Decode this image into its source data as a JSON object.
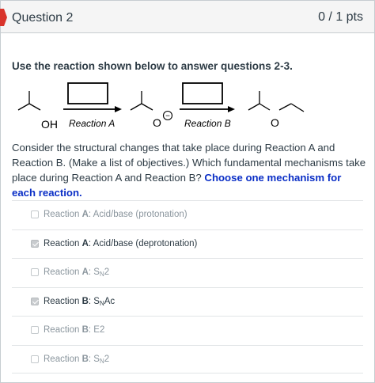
{
  "header": {
    "title": "Question 2",
    "points": "0 / 1 pts",
    "flag_color": "#d9342b"
  },
  "prompt": "Use the reaction shown below to answer questions 2-3.",
  "scheme": {
    "oh_label": "OH",
    "reaction_a": "Reaction A",
    "reaction_b": "Reaction B",
    "o_label": "O",
    "charge": "−"
  },
  "body": {
    "text": "Consider the structural changes that take place during Reaction A and Reaction B. (Make a list of objectives.) Which fundamental mechanisms take place during Reaction A and Reaction B?",
    "emphasis": "Choose one mechanism for each reaction."
  },
  "answers": [
    {
      "prefix": "Reaction A: ",
      "main": "Acid/base (protonation)",
      "sub": "",
      "tail": "",
      "checked": false,
      "style": "muted"
    },
    {
      "prefix": "Reaction A: ",
      "main": "Acid/base (deprotonation)",
      "sub": "",
      "tail": "",
      "checked": true,
      "style": "selected"
    },
    {
      "prefix": "Reaction A: ",
      "main": "S",
      "sub": "N",
      "tail": "2",
      "checked": false,
      "style": "muted"
    },
    {
      "prefix": "Reaction B: ",
      "main": "S",
      "sub": "N",
      "tail": "Ac",
      "checked": true,
      "style": "selected"
    },
    {
      "prefix": "Reaction B: ",
      "main": "E2",
      "sub": "",
      "tail": "",
      "checked": false,
      "style": "muted"
    },
    {
      "prefix": "Reaction B: ",
      "main": "S",
      "sub": "N",
      "tail": "2",
      "checked": false,
      "style": "muted"
    }
  ]
}
